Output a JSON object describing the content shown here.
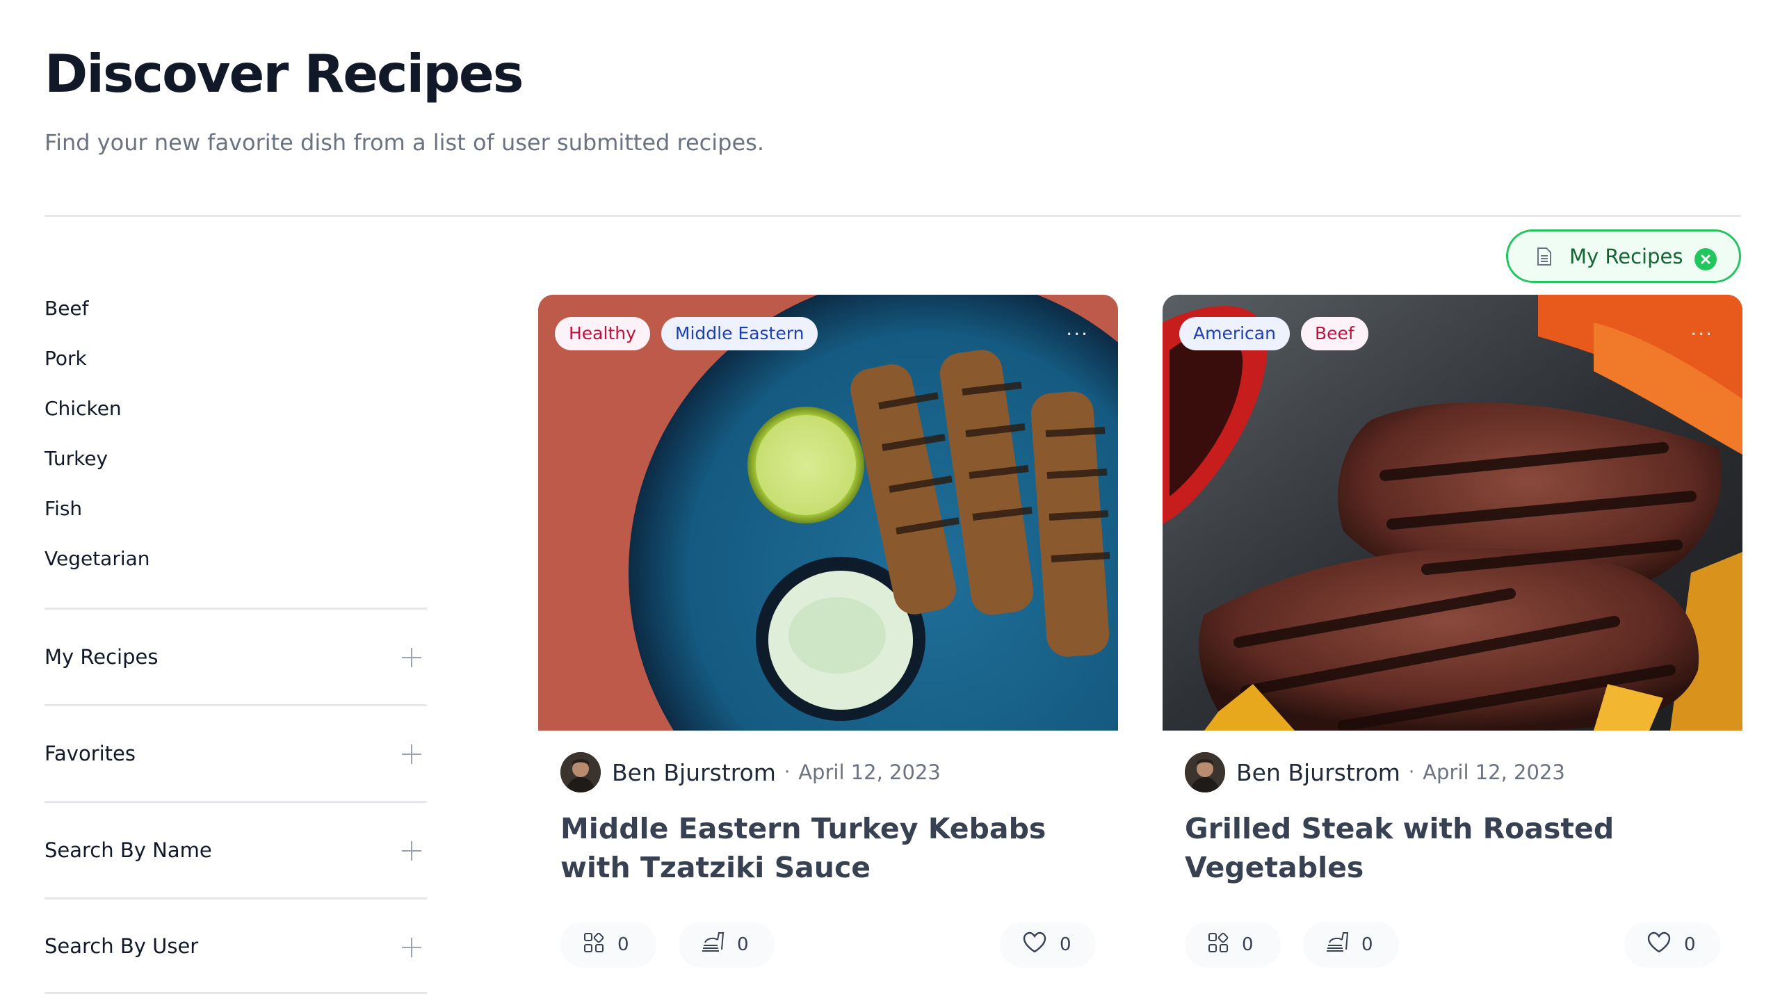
{
  "header": {
    "title": "Discover Recipes",
    "subtitle": "Find your new favorite dish from a list of user submitted recipes."
  },
  "active_filter": {
    "label": "My Recipes",
    "icon": "document-icon",
    "clear_icon": "close-circle-icon",
    "accent": "#22c55e"
  },
  "categories": [
    "Beef",
    "Pork",
    "Chicken",
    "Turkey",
    "Fish",
    "Vegetarian"
  ],
  "accordion": [
    {
      "label": "My Recipes",
      "icon": "plus-icon"
    },
    {
      "label": "Favorites",
      "icon": "plus-icon"
    },
    {
      "label": "Search By Name",
      "icon": "plus-icon"
    },
    {
      "label": "Search By User",
      "icon": "plus-icon"
    }
  ],
  "recipes": [
    {
      "tags": [
        "Healthy",
        "Middle Eastern"
      ],
      "author": "Ben Bjurstrom",
      "separator": "·",
      "date": "April 12, 2023",
      "title": "Middle Eastern Turkey Kebabs with Tzatziki Sauce",
      "ingredients": "0",
      "steps": "0",
      "favorites": "0",
      "more": "···"
    },
    {
      "tags": [
        "American",
        "Beef"
      ],
      "author": "Ben Bjurstrom",
      "separator": "·",
      "date": "April 12, 2023",
      "title": "Grilled Steak with Roasted Vegetables",
      "ingredients": "0",
      "steps": "0",
      "favorites": "0",
      "more": "···"
    }
  ]
}
